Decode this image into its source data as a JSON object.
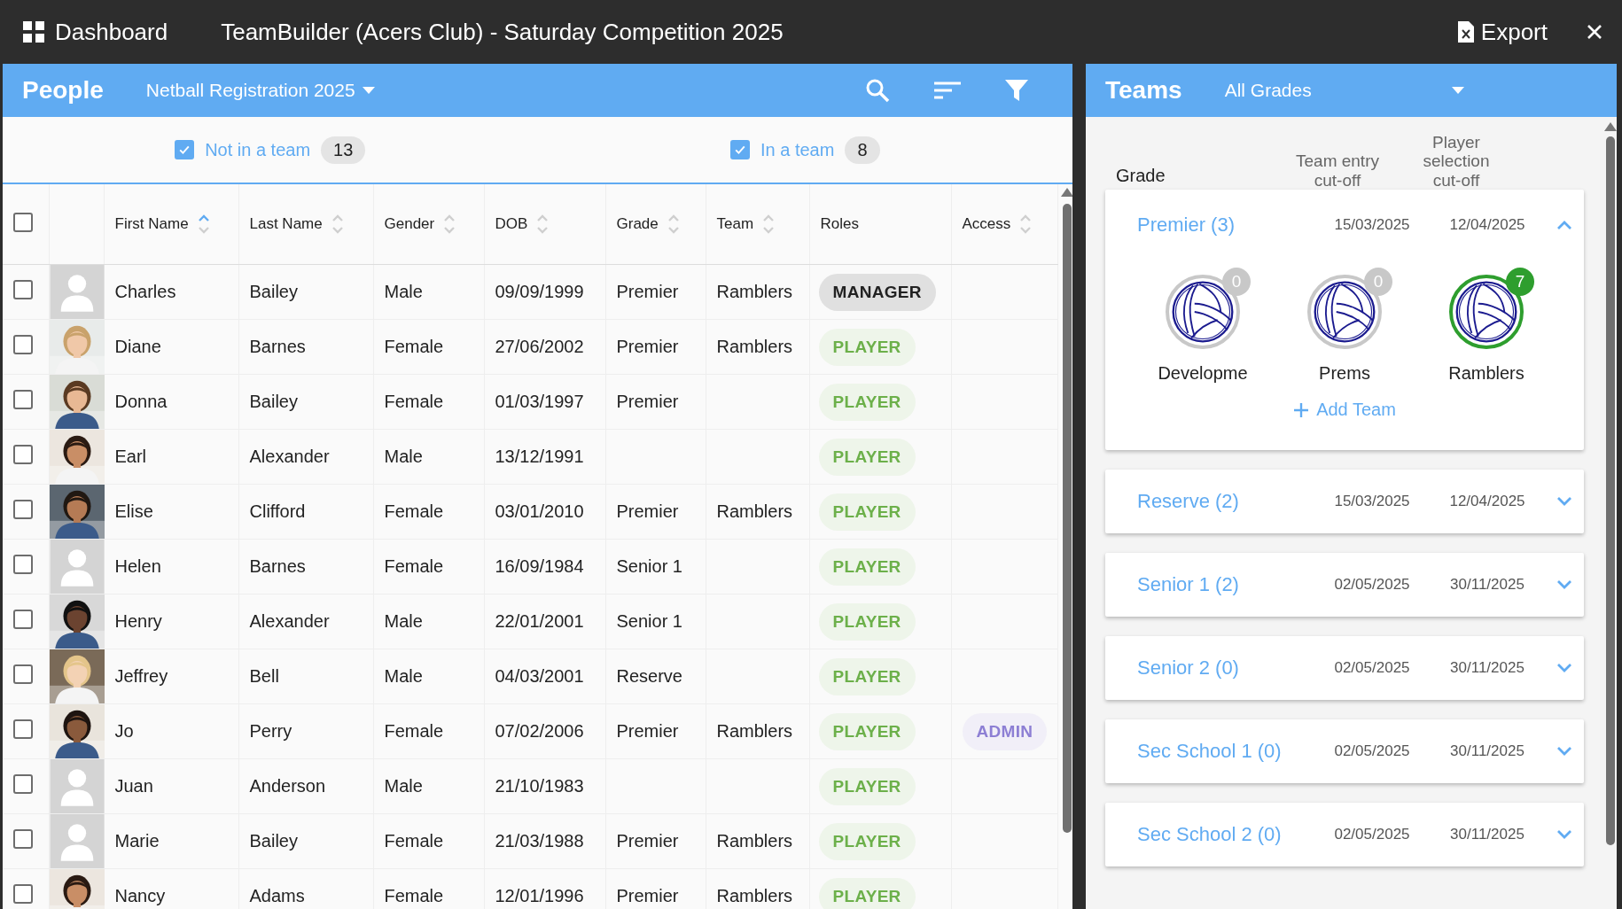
{
  "top_bar": {
    "dashboard": "Dashboard",
    "title": "TeamBuilder (Acers Club) - Saturday Competition 2025",
    "export": "Export"
  },
  "people": {
    "title": "People",
    "registration": "Netball Registration 2025",
    "filters": [
      {
        "label": "Not in a team",
        "count": "13",
        "checked": true
      },
      {
        "label": "In a team",
        "count": "8",
        "checked": true
      }
    ],
    "select_all": {
      "selected": false
    },
    "columns": [
      {
        "label": "First Name",
        "sortable": true,
        "sorted_ascending": true
      },
      {
        "label": "Last Name",
        "sortable": true,
        "sorted_ascending": false
      },
      {
        "label": "Gender",
        "sortable": true,
        "sorted_ascending": false
      },
      {
        "label": "DOB",
        "sortable": true,
        "sorted_ascending": false
      },
      {
        "label": "Grade",
        "sortable": true,
        "sorted_ascending": false
      },
      {
        "label": "Team",
        "sortable": true,
        "sorted_ascending": false
      },
      {
        "label": "Roles",
        "sortable": false
      },
      {
        "label": "Access",
        "sortable": true,
        "sorted_ascending": false
      }
    ],
    "rows": [
      {
        "selected": false,
        "has_photo": false,
        "first": "Charles",
        "last": "Bailey",
        "gender": "Male",
        "dob": "09/09/1999",
        "grade": "Premier",
        "team": "Ramblers",
        "role": {
          "kind": "manager",
          "label": "MANAGER"
        }
      },
      {
        "selected": false,
        "has_photo": true,
        "first": "Diane",
        "last": "Barnes",
        "gender": "Female",
        "dob": "27/06/2002",
        "grade": "Premier",
        "team": "Ramblers",
        "role": {
          "kind": "player",
          "label": "PLAYER"
        }
      },
      {
        "selected": false,
        "has_photo": true,
        "first": "Donna",
        "last": "Bailey",
        "gender": "Female",
        "dob": "01/03/1997",
        "grade": "Premier",
        "role": {
          "kind": "player",
          "label": "PLAYER"
        }
      },
      {
        "selected": false,
        "has_photo": true,
        "first": "Earl",
        "last": "Alexander",
        "gender": "Male",
        "dob": "13/12/1991",
        "role": {
          "kind": "player",
          "label": "PLAYER"
        }
      },
      {
        "selected": false,
        "has_photo": true,
        "first": "Elise",
        "last": "Clifford",
        "gender": "Female",
        "dob": "03/01/2010",
        "grade": "Premier",
        "team": "Ramblers",
        "role": {
          "kind": "player",
          "label": "PLAYER"
        }
      },
      {
        "selected": false,
        "has_photo": false,
        "first": "Helen",
        "last": "Barnes",
        "gender": "Female",
        "dob": "16/09/1984",
        "grade": "Senior 1",
        "role": {
          "kind": "player",
          "label": "PLAYER"
        }
      },
      {
        "selected": false,
        "has_photo": true,
        "first": "Henry",
        "last": "Alexander",
        "gender": "Male",
        "dob": "22/01/2001",
        "grade": "Senior 1",
        "role": {
          "kind": "player",
          "label": "PLAYER"
        }
      },
      {
        "selected": false,
        "has_photo": true,
        "first": "Jeffrey",
        "last": "Bell",
        "gender": "Male",
        "dob": "04/03/2001",
        "grade": "Reserve",
        "role": {
          "kind": "player",
          "label": "PLAYER"
        }
      },
      {
        "selected": false,
        "has_photo": true,
        "first": "Jo",
        "last": "Perry",
        "gender": "Female",
        "dob": "07/02/2006",
        "grade": "Premier",
        "team": "Ramblers",
        "role": {
          "kind": "player",
          "label": "PLAYER"
        },
        "access": {
          "kind": "admin",
          "label": "ADMIN"
        }
      },
      {
        "selected": false,
        "has_photo": false,
        "first": "Juan",
        "last": "Anderson",
        "gender": "Male",
        "dob": "21/10/1983",
        "role": {
          "kind": "player",
          "label": "PLAYER"
        }
      },
      {
        "selected": false,
        "has_photo": false,
        "first": "Marie",
        "last": "Bailey",
        "gender": "Female",
        "dob": "21/03/1988",
        "grade": "Premier",
        "team": "Ramblers",
        "role": {
          "kind": "player",
          "label": "PLAYER"
        }
      },
      {
        "selected": false,
        "has_photo": true,
        "first": "Nancy",
        "last": "Adams",
        "gender": "Female",
        "dob": "12/01/1996",
        "grade": "Premier",
        "team": "Ramblers",
        "role": {
          "kind": "player",
          "label": "PLAYER"
        }
      }
    ]
  },
  "teams": {
    "title": "Teams",
    "grade_filter": "All Grades",
    "headers": {
      "grade": "Grade",
      "entry": "Team entry cut-off",
      "selection": "Player selection cut-off"
    },
    "grades": [
      {
        "name": "Premier (3)",
        "entry": "15/03/2025",
        "selection": "12/04/2025",
        "expanded": true,
        "add_team": "Add Team",
        "teams": [
          {
            "name": "Developme",
            "count": "0",
            "color": "#c8c8c8"
          },
          {
            "name": "Prems",
            "count": "0",
            "color": "#c8c8c8"
          },
          {
            "name": "Ramblers",
            "count": "7",
            "color": "#2e9e2e"
          }
        ]
      },
      {
        "name": "Reserve (2)",
        "entry": "15/03/2025",
        "selection": "12/04/2025",
        "expanded": false
      },
      {
        "name": "Senior 1 (2)",
        "entry": "02/05/2025",
        "selection": "30/11/2025",
        "expanded": false
      },
      {
        "name": "Senior 2 (0)",
        "entry": "02/05/2025",
        "selection": "30/11/2025",
        "expanded": false
      },
      {
        "name": "Sec School 1 (0)",
        "entry": "02/05/2025",
        "selection": "30/11/2025",
        "expanded": false
      },
      {
        "name": "Sec School 2 (0)",
        "entry": "02/05/2025",
        "selection": "30/11/2025",
        "expanded": false
      }
    ]
  }
}
